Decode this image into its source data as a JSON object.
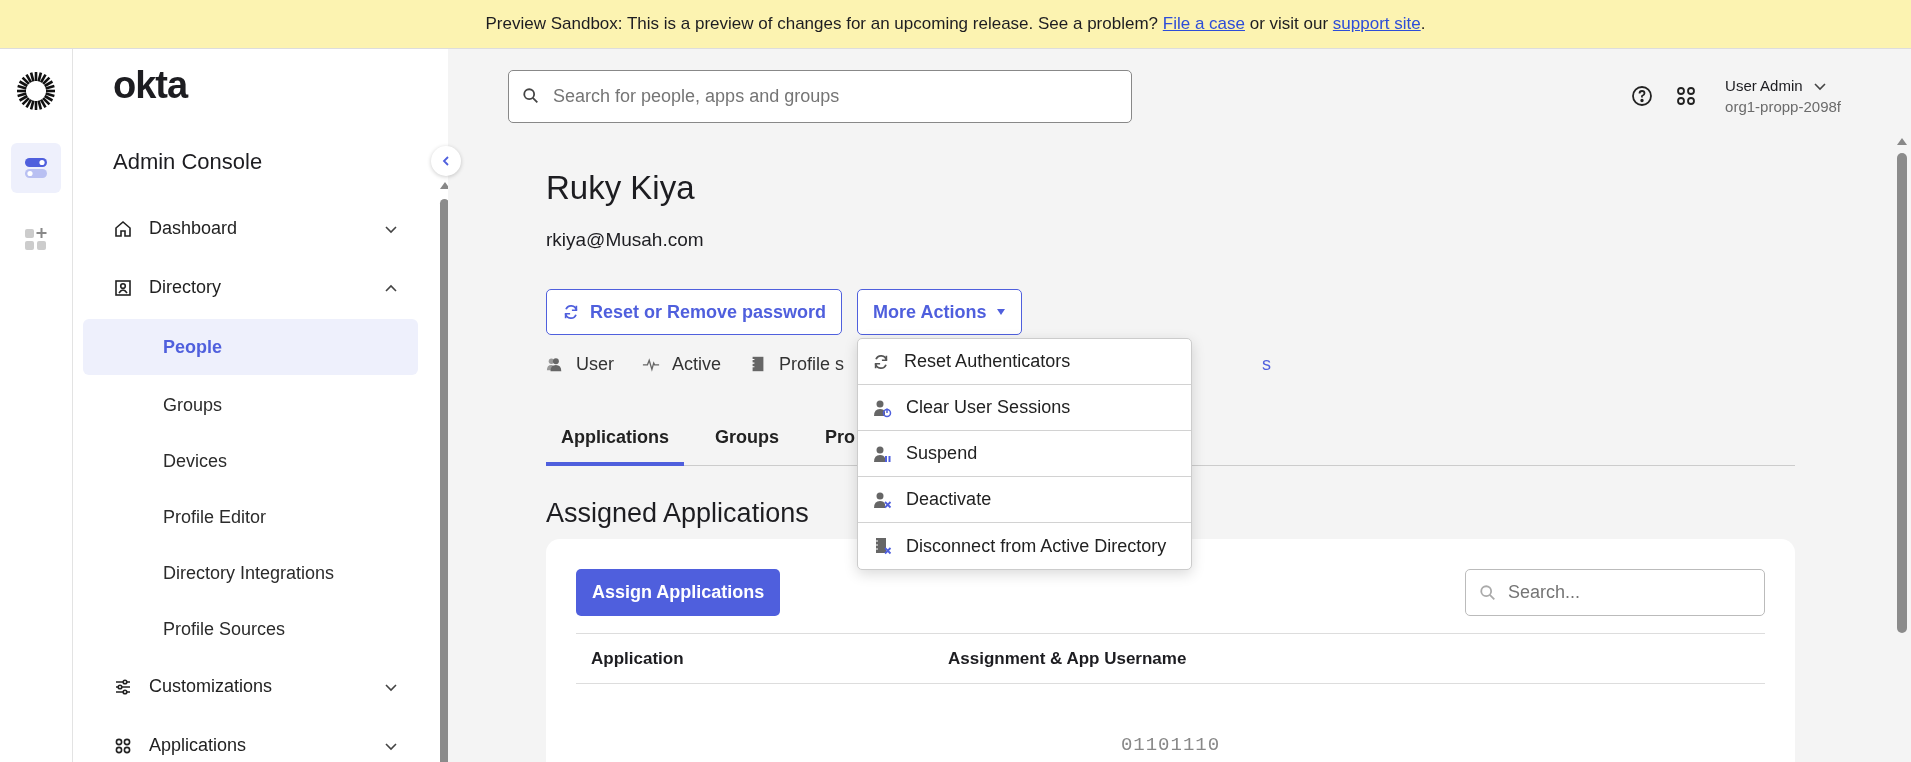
{
  "banner": {
    "text": "Preview Sandbox: This is a preview of changes for an upcoming release. See a problem?",
    "link_1": "File a case",
    "middle": "or visit our",
    "link_2": "support site",
    "end": "."
  },
  "rail": [
    {
      "kind": "toggles",
      "selected": true
    },
    {
      "kind": "add-apps",
      "selected": false
    }
  ],
  "sidebar": {
    "brand": "okta",
    "title": "Admin Console",
    "nav": [
      {
        "label": "Dashboard",
        "expanded": false
      },
      {
        "label": "Directory",
        "expanded": true,
        "children": [
          {
            "label": "People",
            "selected": true
          },
          {
            "label": "Groups",
            "selected": false
          },
          {
            "label": "Devices",
            "selected": false
          },
          {
            "label": "Profile Editor",
            "selected": false
          },
          {
            "label": "Directory Integrations",
            "selected": false
          },
          {
            "label": "Profile Sources",
            "selected": false
          }
        ]
      },
      {
        "label": "Customizations",
        "expanded": false
      },
      {
        "label": "Applications",
        "expanded": false
      }
    ]
  },
  "header": {
    "search": {
      "placeholder": "Search for people, apps and groups"
    },
    "user": "User Admin",
    "org": "org1-propp-2098f"
  },
  "profile": {
    "name": "Ruky Kiya",
    "email": "rkiya@Musah.com",
    "buttons": [
      {
        "label": "Reset or Remove password",
        "kind": "refresh"
      },
      {
        "label": "More Actions",
        "kind": "dropdown"
      }
    ],
    "status": [
      {
        "label": "User"
      },
      {
        "label": "Active"
      },
      {
        "label": "Profile s"
      }
    ],
    "status_link": "s",
    "tabs": [
      {
        "label": "Applications",
        "selected": true
      },
      {
        "label": "Groups",
        "selected": false
      },
      {
        "label": "Pro",
        "selected": false
      }
    ]
  },
  "menu": [
    {
      "label": "Reset Authenticators"
    },
    {
      "label": "Clear User Sessions"
    },
    {
      "label": "Suspend"
    },
    {
      "label": "Deactivate"
    },
    {
      "label": "Disconnect from Active Directory"
    }
  ],
  "section": {
    "title": "Assigned Applications",
    "assign_button": "Assign Applications",
    "search": {
      "placeholder": "Search..."
    },
    "columns": [
      "Application",
      "Assignment & App Username"
    ],
    "loading": "01101110"
  }
}
